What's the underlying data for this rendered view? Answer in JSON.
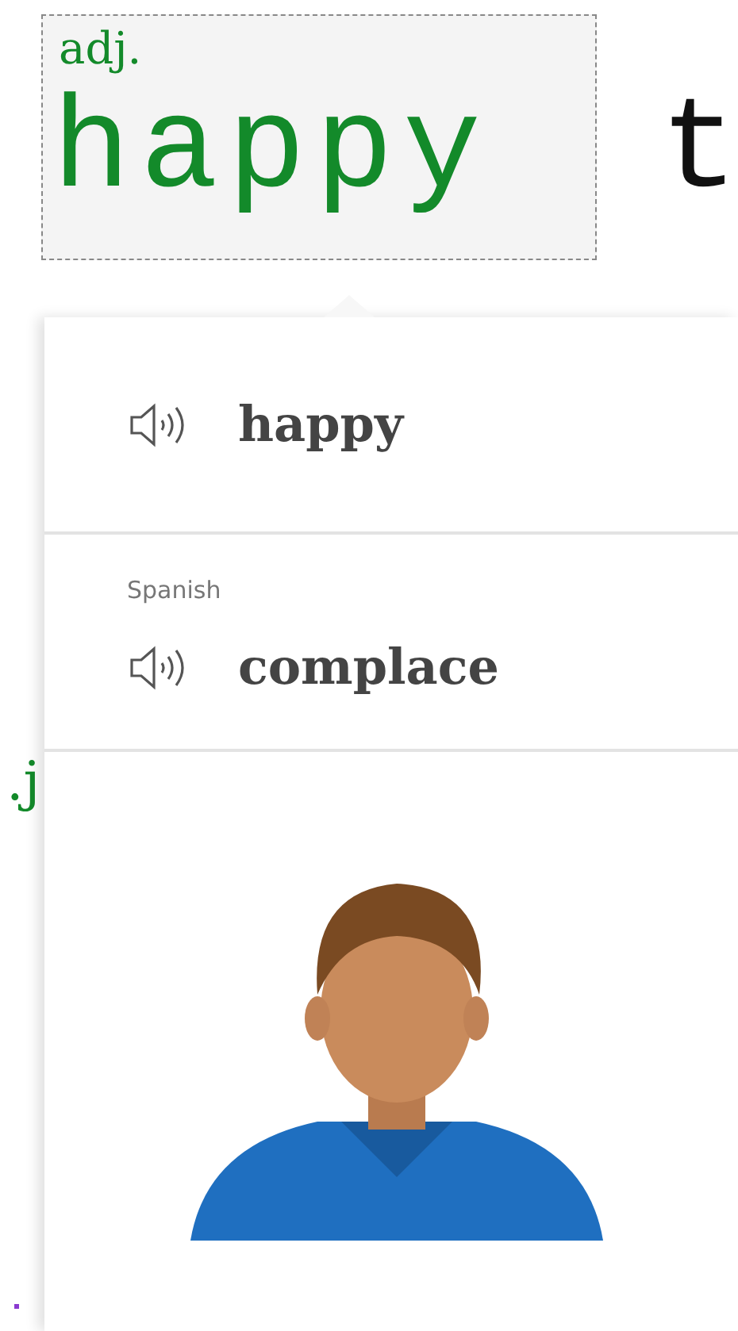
{
  "word_box": {
    "part_of_speech": "adj.",
    "word": "happy"
  },
  "next_word": "t",
  "left_fragments": [
    {
      "text": ".j",
      "kind": "label"
    }
  ],
  "popup": {
    "entries": [
      {
        "word": "happy"
      },
      {
        "language": "Spanish",
        "word": "complace"
      }
    ]
  }
}
